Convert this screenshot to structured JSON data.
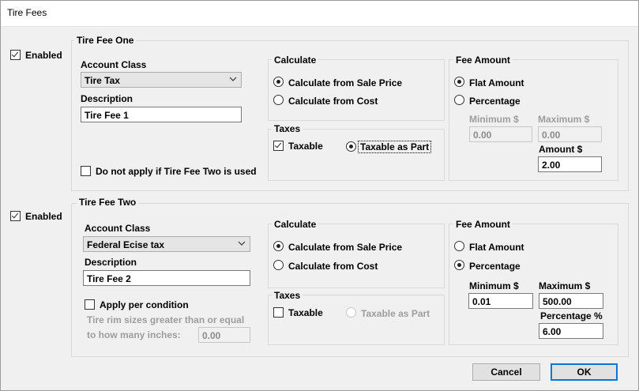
{
  "window": {
    "title": "Tire Fees"
  },
  "fee_one": {
    "group_title": "Tire Fee One",
    "enabled_label": "Enabled",
    "account_class_label": "Account Class",
    "account_class_value": "Tire Tax",
    "description_label": "Description",
    "description_value": "Tire Fee 1",
    "do_not_apply_label": "Do not apply if Tire Fee Two is used",
    "calculate": {
      "title": "Calculate",
      "sale_price_label": "Calculate from Sale Price",
      "cost_label": "Calculate from Cost"
    },
    "taxes": {
      "title": "Taxes",
      "taxable_label": "Taxable",
      "taxable_part_label": "Taxable as Part"
    },
    "fee_amount": {
      "title": "Fee Amount",
      "flat_label": "Flat Amount",
      "percentage_label": "Percentage",
      "minimum_label": "Minimum $",
      "minimum_value": "0.00",
      "maximum_label": "Maximum $",
      "maximum_value": "0.00",
      "amount_label": "Amount $",
      "amount_value": "2.00"
    }
  },
  "fee_two": {
    "group_title": "Tire Fee Two",
    "enabled_label": "Enabled",
    "account_class_label": "Account Class",
    "account_class_value": "Federal Ecise tax",
    "description_label": "Description",
    "description_value": "Tire Fee 2",
    "apply_per_condition_label": "Apply per condition",
    "rim_size_line1": "Tire rim sizes greater than or equal",
    "rim_size_line2": "to how many inches:",
    "rim_size_value": "0.00",
    "calculate": {
      "title": "Calculate",
      "sale_price_label": "Calculate from Sale Price",
      "cost_label": "Calculate from Cost"
    },
    "taxes": {
      "title": "Taxes",
      "taxable_label": "Taxable",
      "taxable_part_label": "Taxable as Part"
    },
    "fee_amount": {
      "title": "Fee Amount",
      "flat_label": "Flat Amount",
      "percentage_label": "Percentage",
      "minimum_label": "Minimum $",
      "minimum_value": "0.01",
      "maximum_label": "Maximum $",
      "maximum_value": "500.00",
      "percentage_pct_label": "Percentage %",
      "percentage_pct_value": "6.00"
    }
  },
  "buttons": {
    "cancel": "Cancel",
    "ok": "OK"
  }
}
